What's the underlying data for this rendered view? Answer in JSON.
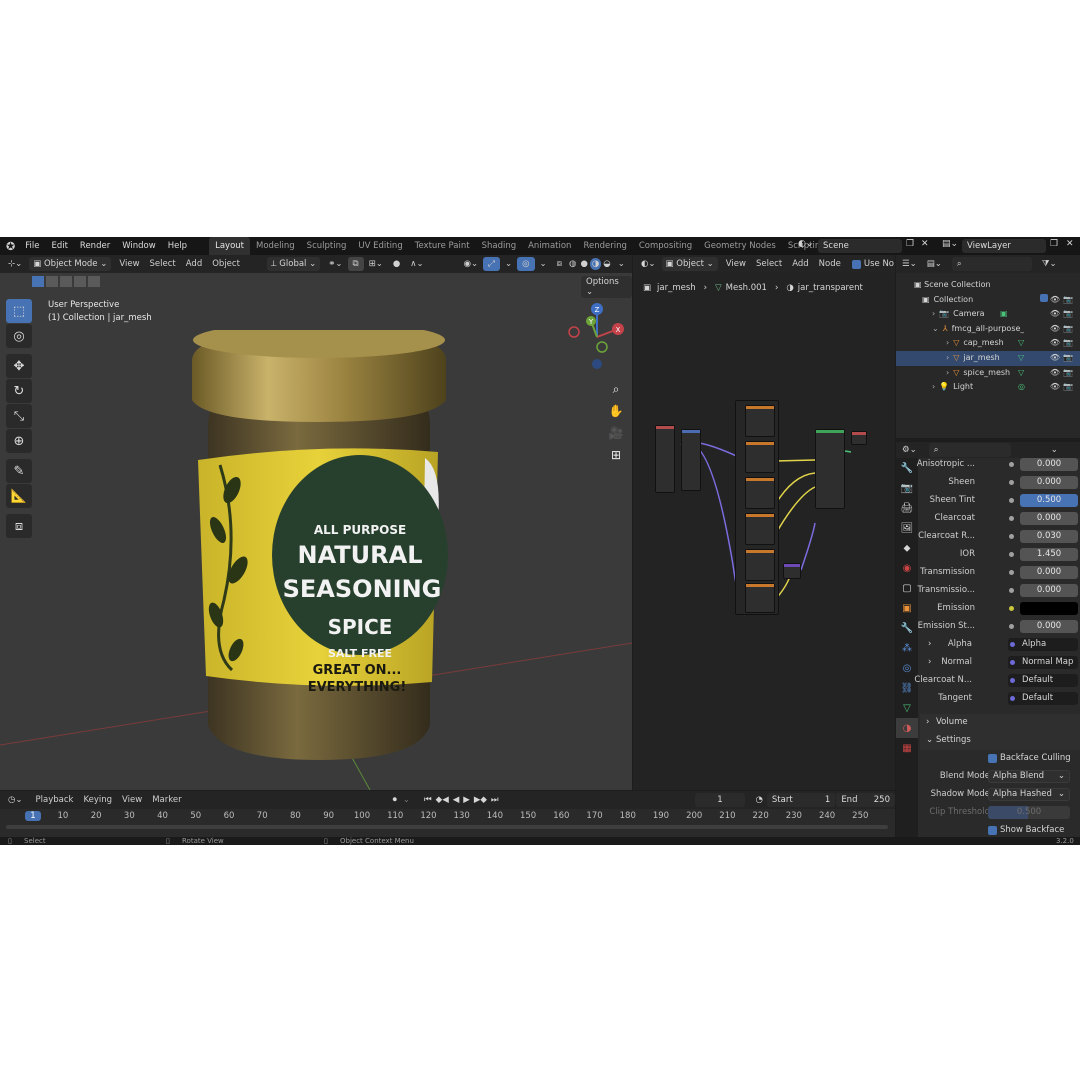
{
  "menu": {
    "items": [
      "File",
      "Edit",
      "Render",
      "Window",
      "Help"
    ],
    "workspaces": [
      "Layout",
      "Modeling",
      "Sculpting",
      "UV Editing",
      "Texture Paint",
      "Shading",
      "Animation",
      "Rendering",
      "Compositing",
      "Geometry Nodes",
      "Scripting"
    ],
    "scene": "Scene",
    "view_layer": "ViewLayer"
  },
  "viewport": {
    "mode": "Object Mode",
    "menus": [
      "View",
      "Select",
      "Add",
      "Object"
    ],
    "orientation": "Global",
    "options": "Options",
    "overlay_title": "User Perspective",
    "overlay_sub": "(1) Collection | jar_mesh",
    "gizmo": {
      "x": "X",
      "y": "Y",
      "z": "Z"
    }
  },
  "jar_label": {
    "line1": "ALL PURPOSE",
    "line2": "NATURAL",
    "line3": "SEASONING",
    "line4": "SPICE",
    "line5": "SALT FREE",
    "line6": "GREAT ON...",
    "line7": "EVERYTHING!"
  },
  "node_editor": {
    "mode": "Object",
    "menus": [
      "View",
      "Select",
      "Add",
      "Node"
    ],
    "use_nodes": "Use No",
    "breadcrumbs": [
      "jar_mesh",
      "Mesh.001",
      "jar_transparent"
    ]
  },
  "outliner": {
    "root": "Scene Collection",
    "items": [
      {
        "name": "Collection",
        "level": 0
      },
      {
        "name": "Camera",
        "level": 1
      },
      {
        "name": "fmcg_all-purpose_se",
        "level": 1
      },
      {
        "name": "cap_mesh",
        "level": 2
      },
      {
        "name": "jar_mesh",
        "level": 2
      },
      {
        "name": "spice_mesh",
        "level": 2
      },
      {
        "name": "Light",
        "level": 1
      }
    ]
  },
  "properties": {
    "rows": [
      {
        "label": "Anisotropic ...",
        "value": "0.000",
        "type": "num"
      },
      {
        "label": "Sheen",
        "value": "0.000",
        "type": "num"
      },
      {
        "label": "Sheen Tint",
        "value": "0.500",
        "type": "num-hl"
      },
      {
        "label": "Clearcoat",
        "value": "0.000",
        "type": "num"
      },
      {
        "label": "Clearcoat R...",
        "value": "0.030",
        "type": "num"
      },
      {
        "label": "IOR",
        "value": "1.450",
        "type": "num"
      },
      {
        "label": "Transmission",
        "value": "0.000",
        "type": "num"
      },
      {
        "label": "Transmissio...",
        "value": "0.000",
        "type": "num"
      },
      {
        "label": "Emission",
        "value": "",
        "type": "color"
      },
      {
        "label": "Emission St...",
        "value": "0.000",
        "type": "num"
      },
      {
        "label": "Alpha",
        "value": "Alpha",
        "type": "sock"
      },
      {
        "label": "Normal",
        "value": "Normal Map",
        "type": "sock"
      },
      {
        "label": "Clearcoat N...",
        "value": "Default",
        "type": "sock"
      },
      {
        "label": "Tangent",
        "value": "Default",
        "type": "sock"
      }
    ],
    "volume": "Volume",
    "settings": "Settings",
    "backface": "Backface Culling",
    "blend_mode_label": "Blend Mode",
    "blend_mode": "Alpha Blend",
    "shadow_mode_label": "Shadow Mode",
    "shadow_mode": "Alpha Hashed",
    "clip_label": "Clip Threshold",
    "clip_value": "0.500",
    "show_backface": "Show Backface"
  },
  "timeline": {
    "menus": [
      "Playback",
      "Keying",
      "View",
      "Marker"
    ],
    "current_frame": "1",
    "start_label": "Start",
    "start": "1",
    "end_label": "End",
    "end": "250",
    "ticks": [
      "1",
      "10",
      "20",
      "30",
      "40",
      "50",
      "60",
      "70",
      "80",
      "90",
      "100",
      "110",
      "120",
      "130",
      "140",
      "150",
      "160",
      "170",
      "180",
      "190",
      "200",
      "210",
      "220",
      "230",
      "240",
      "250"
    ]
  },
  "status": {
    "select": "Select",
    "rotate": "Rotate View",
    "context": "Object Context Menu",
    "version": "3.2.0"
  }
}
